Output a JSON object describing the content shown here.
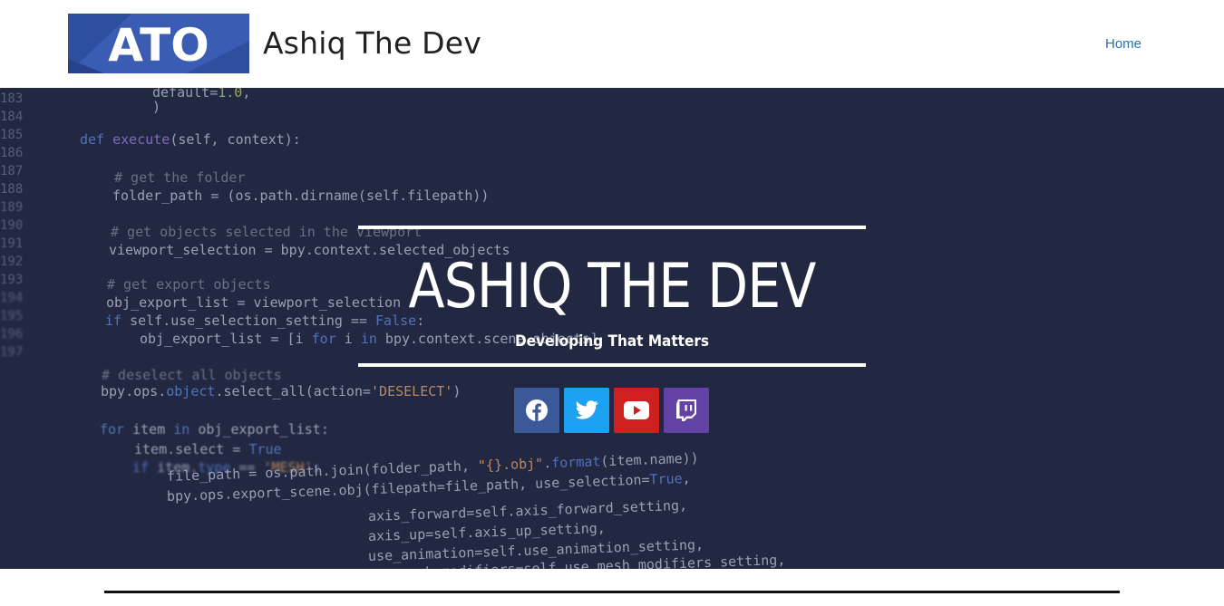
{
  "header": {
    "logo_text": "ATO",
    "site_title": "Ashiq The Dev",
    "nav": [
      {
        "label": "Home"
      }
    ]
  },
  "hero": {
    "title": "ASHIQ THE DEV",
    "subtitle": "Developing That Matters",
    "socials": [
      {
        "name": "facebook",
        "icon": "facebook-icon",
        "color": "#3b5998"
      },
      {
        "name": "twitter",
        "icon": "twitter-icon",
        "color": "#1da1f2"
      },
      {
        "name": "youtube",
        "icon": "youtube-icon",
        "color": "#cd201f"
      },
      {
        "name": "twitch",
        "icon": "twitch-icon",
        "color": "#6441a5"
      }
    ]
  },
  "colors": {
    "hero_bg": "#232842",
    "logo_bg": "#2e4e9e",
    "link": "#2a6fb5"
  }
}
